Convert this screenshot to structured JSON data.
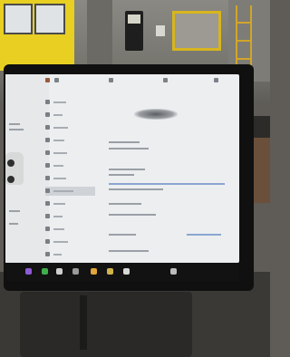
{
  "scene": {
    "description_colors": {
      "door": "#e8cf22",
      "screen": "#eceef0",
      "bezel": "#101010"
    }
  },
  "display": {
    "menu_items": [
      "",
      "",
      "",
      "",
      "",
      "",
      "",
      "",
      "",
      "",
      "",
      "",
      "",
      ""
    ]
  },
  "taskbar": {
    "icons": [
      "media-icon",
      "phone-icon",
      "music-icon",
      "app-icon",
      "app-icon",
      "app-icon",
      "app-icon",
      "volume-icon"
    ]
  }
}
